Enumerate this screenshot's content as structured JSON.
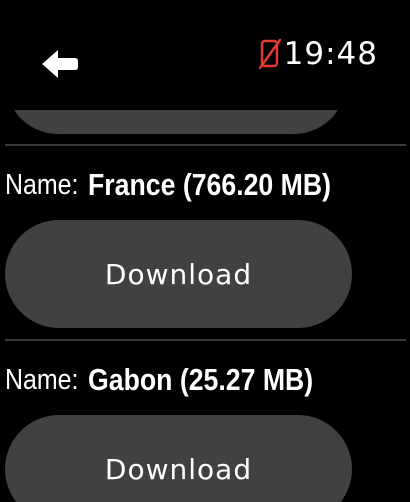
{
  "status": {
    "time": "19:48",
    "no_phone_icon": "phone-disconnected-icon",
    "no_phone_color": "#e53935"
  },
  "nav": {
    "back_icon": "back-arrow-icon"
  },
  "items": [
    {
      "name_label": "Name:",
      "name_value": "France (766.20 MB)",
      "download_label": "Download"
    },
    {
      "name_label": "Name:",
      "name_value": "Gabon (25.27 MB)",
      "download_label": "Download"
    }
  ],
  "colors": {
    "background": "#000000",
    "button": "#414141",
    "divider": "#3a3a3a",
    "text": "#ffffff"
  }
}
